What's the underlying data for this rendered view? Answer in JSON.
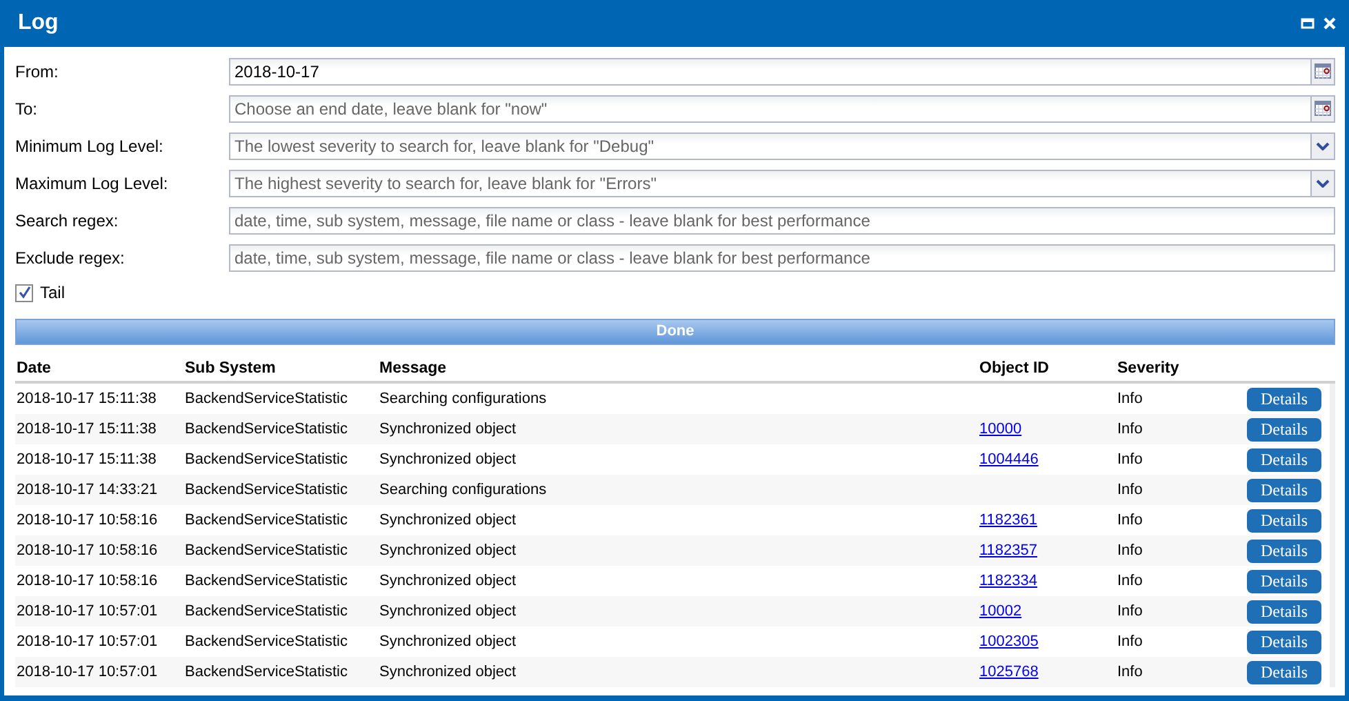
{
  "window": {
    "title": "Log"
  },
  "fields": [
    {
      "label": "From:",
      "kind": "date",
      "value": "2018-10-17"
    },
    {
      "label": "To:",
      "kind": "date",
      "placeholder": "Choose an end date, leave blank for \"now\""
    },
    {
      "label": "Minimum Log Level:",
      "kind": "select",
      "placeholder": "The lowest severity to search for, leave blank for \"Debug\""
    },
    {
      "label": "Maximum Log Level:",
      "kind": "select",
      "placeholder": "The highest severity to search for, leave blank for \"Errors\""
    },
    {
      "label": "Search regex:",
      "kind": "text",
      "placeholder": "date, time, sub system, message, file name or class - leave blank for best performance"
    },
    {
      "label": "Exclude regex:",
      "kind": "text",
      "placeholder": "date, time, sub system, message, file name or class - leave blank for best performance"
    }
  ],
  "tail": {
    "label": "Tail",
    "checked": true
  },
  "progress": {
    "label": "Done",
    "level": 1
  },
  "table": {
    "columns": [
      "Date",
      "Sub System",
      "Message",
      "Object ID",
      "Severity"
    ],
    "rows": [
      {
        "date": "2018-10-17 15:11:38",
        "sub_system": "BackendServiceStatistic",
        "message": "Searching configurations",
        "severity": "Info",
        "action": "Details"
      },
      {
        "date": "2018-10-17 15:11:38",
        "sub_system": "BackendServiceStatistic",
        "message": "Synchronized object",
        "object_id": "10000",
        "severity": "Info",
        "action": "Details"
      },
      {
        "date": "2018-10-17 15:11:38",
        "sub_system": "BackendServiceStatistic",
        "message": "Synchronized object",
        "object_id": "1004446",
        "severity": "Info",
        "action": "Details"
      },
      {
        "date": "2018-10-17 14:33:21",
        "sub_system": "BackendServiceStatistic",
        "message": "Searching configurations",
        "severity": "Info",
        "action": "Details"
      },
      {
        "date": "2018-10-17 10:58:16",
        "sub_system": "BackendServiceStatistic",
        "message": "Synchronized object",
        "object_id": "1182361",
        "severity": "Info",
        "action": "Details"
      },
      {
        "date": "2018-10-17 10:58:16",
        "sub_system": "BackendServiceStatistic",
        "message": "Synchronized object",
        "object_id": "1182357",
        "severity": "Info",
        "action": "Details"
      },
      {
        "date": "2018-10-17 10:58:16",
        "sub_system": "BackendServiceStatistic",
        "message": "Synchronized object",
        "object_id": "1182334",
        "severity": "Info",
        "action": "Details"
      },
      {
        "date": "2018-10-17 10:57:01",
        "sub_system": "BackendServiceStatistic",
        "message": "Synchronized object",
        "object_id": "10002",
        "severity": "Info",
        "action": "Details"
      },
      {
        "date": "2018-10-17 10:57:01",
        "sub_system": "BackendServiceStatistic",
        "message": "Synchronized object",
        "object_id": "1002305",
        "severity": "Info",
        "action": "Details"
      },
      {
        "date": "2018-10-17 10:57:01",
        "sub_system": "BackendServiceStatistic",
        "message": "Synchronized object",
        "object_id": "1025768",
        "severity": "Info",
        "action": "Details"
      }
    ]
  }
}
